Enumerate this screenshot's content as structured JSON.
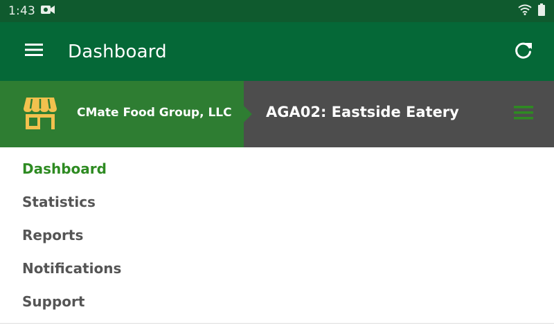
{
  "status": {
    "time": "1:43",
    "icons": [
      "video-recording-icon",
      "wifi-icon",
      "battery-icon"
    ]
  },
  "app_bar": {
    "title": "Dashboard",
    "menu_icon": "hamburger-menu-icon",
    "refresh_icon": "refresh-icon"
  },
  "location": {
    "company": "CMate Food Group, LLC",
    "site": "AGA02: Eastside Eatery",
    "store_icon": "storefront-icon",
    "menu_icon": "hamburger-menu-icon"
  },
  "nav": {
    "items": [
      {
        "label": "Dashboard",
        "active": true
      },
      {
        "label": "Statistics",
        "active": false
      },
      {
        "label": "Reports",
        "active": false
      },
      {
        "label": "Notifications",
        "active": false
      },
      {
        "label": "Support",
        "active": false
      }
    ]
  },
  "colors": {
    "status_bar": "#0f5a2e",
    "app_bar": "#056837",
    "company_block": "#2e7d32",
    "site_block": "#4d4d4d",
    "active_nav": "#2e8b22",
    "nav_text": "#555555",
    "store_icon": "#f2c14e",
    "site_menu_icon": "#2e8b22"
  }
}
